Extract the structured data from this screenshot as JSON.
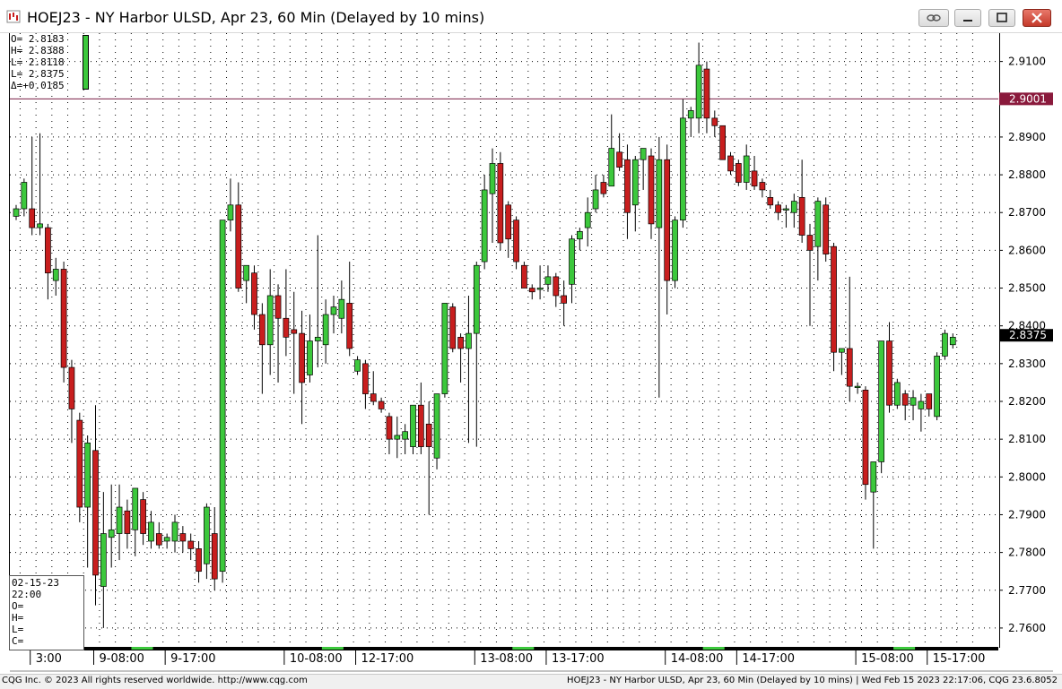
{
  "window": {
    "title": "HOEJ23 - NY Harbor ULSD, Apr 23, 60 Min (Delayed by 10 mins)",
    "icon": "cqg-chart-icon",
    "buttons": [
      "link-icon",
      "minimize-icon",
      "maximize-icon",
      "close-icon"
    ]
  },
  "ohlc_readout": {
    "open": "O= 2.8183",
    "high": "H= 2.8388",
    "low": "L= 2.8118",
    "last": "L= 2.8375",
    "delta": "Δ=+0.0185"
  },
  "cursor_box": {
    "date": "02-15-23",
    "time": "22:00",
    "o": "O=",
    "h": "H=",
    "l": "L=",
    "c": "C="
  },
  "footer": {
    "left": "CQG Inc. © 2023 All rights reserved worldwide. http://www.cqg.com",
    "right": "HOEJ23 - NY Harbor ULSD, Apr 23, 60 Min (Delayed by 10 mins) | Wed Feb 15 2023 22:17:06, CQG 23.6.8052"
  },
  "colors": {
    "up": "#3cc83c",
    "down": "#c81e1e",
    "marker_line": "#7a1f45",
    "marker_label_bg": "#8a1a3c",
    "last_label_bg": "#000000",
    "grid": "#000000"
  },
  "chart_data": {
    "type": "candlestick",
    "ylim": [
      2.755,
      2.9175
    ],
    "y_ticks": [
      2.76,
      2.77,
      2.78,
      2.79,
      2.8,
      2.81,
      2.82,
      2.83,
      2.84,
      2.85,
      2.86,
      2.87,
      2.88,
      2.89,
      2.91
    ],
    "y_tick_labels": [
      "2.7600",
      "2.7700",
      "2.7800",
      "2.7900",
      "2.8000",
      "2.8100",
      "2.8200",
      "2.8300",
      "2.8400",
      "2.8500",
      "2.8600",
      "2.8700",
      "2.8800",
      "2.8900",
      "2.9100"
    ],
    "x_labels": [
      {
        "bar": 2,
        "text": "3:00"
      },
      {
        "bar": 10,
        "text": "9-08:00"
      },
      {
        "bar": 19,
        "text": "9-17:00"
      },
      {
        "bar": 34,
        "text": "10-08:00"
      },
      {
        "bar": 43,
        "text": "12-17:00"
      },
      {
        "bar": 58,
        "text": "13-08:00"
      },
      {
        "bar": 67,
        "text": "13-17:00"
      },
      {
        "bar": 82,
        "text": "14-08:00"
      },
      {
        "bar": 91,
        "text": "14-17:00"
      },
      {
        "bar": 106,
        "text": "15-08:00"
      },
      {
        "bar": 115,
        "text": "15-17:00"
      }
    ],
    "horizontal_line": {
      "value": 2.9001,
      "label": "2.9001"
    },
    "last_price": {
      "value": 2.8375,
      "label": "2.8375"
    },
    "bars": [
      {
        "o": 2.869,
        "h": 2.872,
        "l": 2.868,
        "c": 2.871
      },
      {
        "o": 2.871,
        "h": 2.879,
        "l": 2.869,
        "c": 2.878
      },
      {
        "o": 2.871,
        "h": 2.89,
        "l": 2.864,
        "c": 2.866
      },
      {
        "o": 2.866,
        "h": 2.891,
        "l": 2.864,
        "c": 2.867
      },
      {
        "o": 2.866,
        "h": 2.867,
        "l": 2.847,
        "c": 2.854
      },
      {
        "o": 2.852,
        "h": 2.858,
        "l": 2.848,
        "c": 2.855
      },
      {
        "o": 2.855,
        "h": 2.857,
        "l": 2.825,
        "c": 2.829
      },
      {
        "o": 2.829,
        "h": 2.831,
        "l": 2.809,
        "c": 2.818
      },
      {
        "o": 2.815,
        "h": 2.817,
        "l": 2.788,
        "c": 2.792
      },
      {
        "o": 2.792,
        "h": 2.811,
        "l": 2.776,
        "c": 2.809
      },
      {
        "o": 2.807,
        "h": 2.819,
        "l": 2.766,
        "c": 2.774
      },
      {
        "o": 2.771,
        "h": 2.796,
        "l": 2.76,
        "c": 2.785
      },
      {
        "o": 2.784,
        "h": 2.798,
        "l": 2.776,
        "c": 2.786
      },
      {
        "o": 2.785,
        "h": 2.798,
        "l": 2.778,
        "c": 2.792
      },
      {
        "o": 2.791,
        "h": 2.794,
        "l": 2.781,
        "c": 2.785
      },
      {
        "o": 2.786,
        "h": 2.797,
        "l": 2.779,
        "c": 2.797
      },
      {
        "o": 2.794,
        "h": 2.796,
        "l": 2.782,
        "c": 2.785
      },
      {
        "o": 2.783,
        "h": 2.791,
        "l": 2.781,
        "c": 2.788
      },
      {
        "o": 2.785,
        "h": 2.788,
        "l": 2.781,
        "c": 2.782
      },
      {
        "o": 2.783,
        "h": 2.785,
        "l": 2.781,
        "c": 2.784
      },
      {
        "o": 2.783,
        "h": 2.79,
        "l": 2.78,
        "c": 2.788
      },
      {
        "o": 2.785,
        "h": 2.787,
        "l": 2.78,
        "c": 2.783
      },
      {
        "o": 2.783,
        "h": 2.785,
        "l": 2.778,
        "c": 2.781
      },
      {
        "o": 2.781,
        "h": 2.783,
        "l": 2.772,
        "c": 2.775
      },
      {
        "o": 2.777,
        "h": 2.793,
        "l": 2.773,
        "c": 2.792
      },
      {
        "o": 2.785,
        "h": 2.792,
        "l": 2.77,
        "c": 2.773
      },
      {
        "o": 2.775,
        "h": 2.868,
        "l": 2.772,
        "c": 2.868
      },
      {
        "o": 2.868,
        "h": 2.879,
        "l": 2.865,
        "c": 2.872
      },
      {
        "o": 2.872,
        "h": 2.878,
        "l": 2.849,
        "c": 2.85
      },
      {
        "o": 2.852,
        "h": 2.856,
        "l": 2.846,
        "c": 2.856
      },
      {
        "o": 2.854,
        "h": 2.856,
        "l": 2.839,
        "c": 2.843
      },
      {
        "o": 2.843,
        "h": 2.846,
        "l": 2.822,
        "c": 2.835
      },
      {
        "o": 2.835,
        "h": 2.855,
        "l": 2.827,
        "c": 2.848
      },
      {
        "o": 2.848,
        "h": 2.851,
        "l": 2.825,
        "c": 2.842
      },
      {
        "o": 2.842,
        "h": 2.855,
        "l": 2.832,
        "c": 2.837
      },
      {
        "o": 2.839,
        "h": 2.849,
        "l": 2.822,
        "c": 2.838
      },
      {
        "o": 2.838,
        "h": 2.844,
        "l": 2.814,
        "c": 2.825
      },
      {
        "o": 2.827,
        "h": 2.843,
        "l": 2.825,
        "c": 2.836
      },
      {
        "o": 2.836,
        "h": 2.864,
        "l": 2.829,
        "c": 2.837
      },
      {
        "o": 2.835,
        "h": 2.847,
        "l": 2.83,
        "c": 2.843
      },
      {
        "o": 2.843,
        "h": 2.848,
        "l": 2.838,
        "c": 2.845
      },
      {
        "o": 2.842,
        "h": 2.852,
        "l": 2.838,
        "c": 2.847
      },
      {
        "o": 2.846,
        "h": 2.857,
        "l": 2.832,
        "c": 2.834
      },
      {
        "o": 2.828,
        "h": 2.832,
        "l": 2.827,
        "c": 2.831
      },
      {
        "o": 2.83,
        "h": 2.831,
        "l": 2.818,
        "c": 2.822
      },
      {
        "o": 2.822,
        "h": 2.828,
        "l": 2.819,
        "c": 2.82
      },
      {
        "o": 2.82,
        "h": 2.821,
        "l": 2.817,
        "c": 2.818
      },
      {
        "o": 2.816,
        "h": 2.817,
        "l": 2.806,
        "c": 2.81
      },
      {
        "o": 2.81,
        "h": 2.816,
        "l": 2.805,
        "c": 2.811
      },
      {
        "o": 2.81,
        "h": 2.814,
        "l": 2.806,
        "c": 2.812
      },
      {
        "o": 2.808,
        "h": 2.819,
        "l": 2.806,
        "c": 2.819
      },
      {
        "o": 2.819,
        "h": 2.825,
        "l": 2.806,
        "c": 2.808
      },
      {
        "o": 2.814,
        "h": 2.82,
        "l": 2.79,
        "c": 2.808
      },
      {
        "o": 2.805,
        "h": 2.822,
        "l": 2.802,
        "c": 2.822
      },
      {
        "o": 2.822,
        "h": 2.846,
        "l": 2.821,
        "c": 2.846
      },
      {
        "o": 2.845,
        "h": 2.846,
        "l": 2.833,
        "c": 2.834
      },
      {
        "o": 2.837,
        "h": 2.838,
        "l": 2.825,
        "c": 2.834
      },
      {
        "o": 2.834,
        "h": 2.848,
        "l": 2.809,
        "c": 2.838
      },
      {
        "o": 2.838,
        "h": 2.857,
        "l": 2.808,
        "c": 2.856
      },
      {
        "o": 2.857,
        "h": 2.88,
        "l": 2.855,
        "c": 2.876
      },
      {
        "o": 2.875,
        "h": 2.887,
        "l": 2.862,
        "c": 2.883
      },
      {
        "o": 2.883,
        "h": 2.886,
        "l": 2.86,
        "c": 2.862
      },
      {
        "o": 2.872,
        "h": 2.873,
        "l": 2.858,
        "c": 2.863
      },
      {
        "o": 2.868,
        "h": 2.869,
        "l": 2.855,
        "c": 2.857
      },
      {
        "o": 2.856,
        "h": 2.857,
        "l": 2.85,
        "c": 2.85
      },
      {
        "o": 2.85,
        "h": 2.851,
        "l": 2.847,
        "c": 2.849
      },
      {
        "o": 2.85,
        "h": 2.856,
        "l": 2.847,
        "c": 2.85
      },
      {
        "o": 2.851,
        "h": 2.856,
        "l": 2.849,
        "c": 2.853
      },
      {
        "o": 2.853,
        "h": 2.854,
        "l": 2.845,
        "c": 2.848
      },
      {
        "o": 2.848,
        "h": 2.852,
        "l": 2.84,
        "c": 2.846
      },
      {
        "o": 2.851,
        "h": 2.864,
        "l": 2.846,
        "c": 2.863
      },
      {
        "o": 2.863,
        "h": 2.866,
        "l": 2.86,
        "c": 2.865
      },
      {
        "o": 2.866,
        "h": 2.874,
        "l": 2.861,
        "c": 2.87
      },
      {
        "o": 2.871,
        "h": 2.88,
        "l": 2.87,
        "c": 2.876
      },
      {
        "o": 2.878,
        "h": 2.88,
        "l": 2.874,
        "c": 2.875
      },
      {
        "o": 2.877,
        "h": 2.896,
        "l": 2.877,
        "c": 2.887
      },
      {
        "o": 2.886,
        "h": 2.891,
        "l": 2.881,
        "c": 2.882
      },
      {
        "o": 2.884,
        "h": 2.888,
        "l": 2.863,
        "c": 2.87
      },
      {
        "o": 2.872,
        "h": 2.885,
        "l": 2.865,
        "c": 2.884
      },
      {
        "o": 2.884,
        "h": 2.887,
        "l": 2.876,
        "c": 2.887
      },
      {
        "o": 2.885,
        "h": 2.887,
        "l": 2.863,
        "c": 2.867
      },
      {
        "o": 2.866,
        "h": 2.89,
        "l": 2.821,
        "c": 2.884
      },
      {
        "o": 2.884,
        "h": 2.888,
        "l": 2.843,
        "c": 2.852
      },
      {
        "o": 2.852,
        "h": 2.869,
        "l": 2.85,
        "c": 2.868
      },
      {
        "o": 2.868,
        "h": 2.9,
        "l": 2.866,
        "c": 2.895
      },
      {
        "o": 2.895,
        "h": 2.898,
        "l": 2.89,
        "c": 2.897
      },
      {
        "o": 2.895,
        "h": 2.915,
        "l": 2.891,
        "c": 2.909
      },
      {
        "o": 2.908,
        "h": 2.91,
        "l": 2.891,
        "c": 2.895
      },
      {
        "o": 2.895,
        "h": 2.897,
        "l": 2.89,
        "c": 2.893
      },
      {
        "o": 2.893,
        "h": 2.893,
        "l": 2.884,
        "c": 2.884
      },
      {
        "o": 2.885,
        "h": 2.886,
        "l": 2.88,
        "c": 2.881
      },
      {
        "o": 2.883,
        "h": 2.884,
        "l": 2.877,
        "c": 2.878
      },
      {
        "o": 2.878,
        "h": 2.888,
        "l": 2.876,
        "c": 2.885
      },
      {
        "o": 2.881,
        "h": 2.885,
        "l": 2.876,
        "c": 2.877
      },
      {
        "o": 2.878,
        "h": 2.879,
        "l": 2.874,
        "c": 2.876
      },
      {
        "o": 2.874,
        "h": 2.876,
        "l": 2.871,
        "c": 2.872
      },
      {
        "o": 2.872,
        "h": 2.873,
        "l": 2.868,
        "c": 2.87
      },
      {
        "o": 2.871,
        "h": 2.872,
        "l": 2.866,
        "c": 2.871
      },
      {
        "o": 2.87,
        "h": 2.875,
        "l": 2.866,
        "c": 2.873
      },
      {
        "o": 2.874,
        "h": 2.884,
        "l": 2.862,
        "c": 2.864
      },
      {
        "o": 2.864,
        "h": 2.867,
        "l": 2.84,
        "c": 2.86
      },
      {
        "o": 2.861,
        "h": 2.874,
        "l": 2.852,
        "c": 2.873
      },
      {
        "o": 2.872,
        "h": 2.874,
        "l": 2.857,
        "c": 2.859
      },
      {
        "o": 2.861,
        "h": 2.862,
        "l": 2.828,
        "c": 2.833
      },
      {
        "o": 2.833,
        "h": 2.834,
        "l": 2.827,
        "c": 2.834
      },
      {
        "o": 2.834,
        "h": 2.853,
        "l": 2.82,
        "c": 2.824
      },
      {
        "o": 2.824,
        "h": 2.825,
        "l": 2.822,
        "c": 2.824
      },
      {
        "o": 2.823,
        "h": 2.824,
        "l": 2.794,
        "c": 2.798
      },
      {
        "o": 2.796,
        "h": 2.804,
        "l": 2.781,
        "c": 2.804
      },
      {
        "o": 2.804,
        "h": 2.836,
        "l": 2.801,
        "c": 2.836
      },
      {
        "o": 2.836,
        "h": 2.841,
        "l": 2.817,
        "c": 2.819
      },
      {
        "o": 2.819,
        "h": 2.826,
        "l": 2.818,
        "c": 2.825
      },
      {
        "o": 2.822,
        "h": 2.823,
        "l": 2.815,
        "c": 2.819
      },
      {
        "o": 2.819,
        "h": 2.823,
        "l": 2.815,
        "c": 2.821
      },
      {
        "o": 2.818,
        "h": 2.822,
        "l": 2.812,
        "c": 2.82
      },
      {
        "o": 2.822,
        "h": 2.822,
        "l": 2.816,
        "c": 2.818
      },
      {
        "o": 2.816,
        "h": 2.833,
        "l": 2.815,
        "c": 2.832
      },
      {
        "o": 2.832,
        "h": 2.839,
        "l": 2.831,
        "c": 2.838
      },
      {
        "o": 2.835,
        "h": 2.838,
        "l": 2.834,
        "c": 2.837
      }
    ]
  }
}
